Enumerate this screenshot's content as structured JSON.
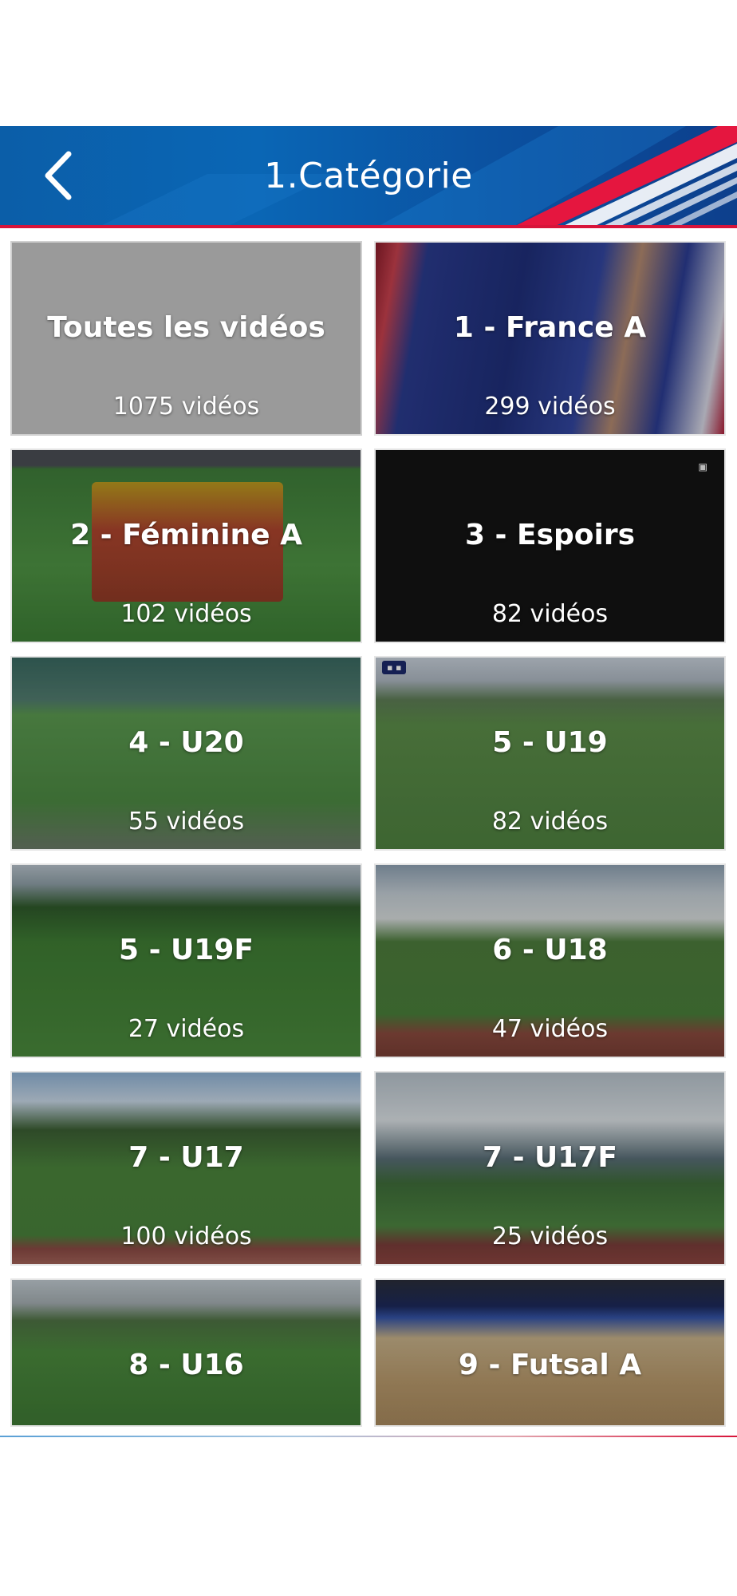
{
  "header": {
    "title": "1.Catégorie",
    "back_icon": "chevron-left-icon",
    "colors": {
      "primary": "#0b5ea8",
      "accent": "#d8143a"
    }
  },
  "categories": [
    {
      "label": "Toutes les vidéos",
      "count": "1075 vidéos"
    },
    {
      "label": "1 - France A",
      "count": "299 vidéos"
    },
    {
      "label": "2 - Féminine A",
      "count": "102 vidéos"
    },
    {
      "label": "3 - Espoirs",
      "count": "82 vidéos"
    },
    {
      "label": "4 - U20",
      "count": "55 vidéos"
    },
    {
      "label": "5 - U19",
      "count": "82 vidéos"
    },
    {
      "label": "5 - U19F",
      "count": "27 vidéos"
    },
    {
      "label": "6 - U18",
      "count": "47 vidéos"
    },
    {
      "label": "7 - U17",
      "count": "100 vidéos"
    },
    {
      "label": "7 - U17F",
      "count": "25 vidéos"
    },
    {
      "label": "8 - U16",
      "count": ""
    },
    {
      "label": "9 - Futsal A",
      "count": ""
    }
  ]
}
